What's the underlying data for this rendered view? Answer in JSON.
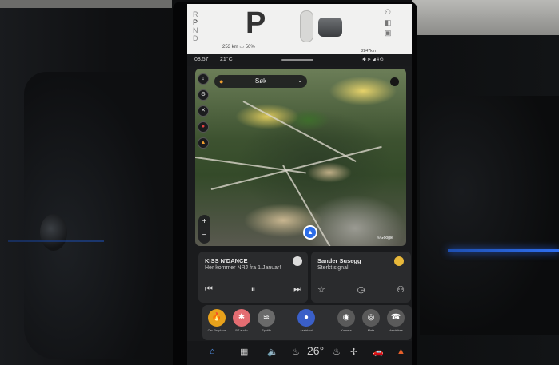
{
  "status": {
    "gears": [
      "R",
      "P",
      "N",
      "D"
    ],
    "current_gear": "P",
    "range": "253 km",
    "battery": "56%",
    "odometer": "2847km"
  },
  "topbar": {
    "time": "08:57",
    "outside_temp": "21°C",
    "network": "4G"
  },
  "map": {
    "search_placeholder": "Søk",
    "zoom_in": "+",
    "zoom_out": "−",
    "attribution": "©Google"
  },
  "media_card": {
    "station": "KISS N'DANCE",
    "track": "Her kommer NRJ fra 1.Januar!",
    "controls": [
      "previous",
      "pause",
      "next"
    ]
  },
  "contact_card": {
    "name": "Sander Susegg",
    "status": "Sterkt signal"
  },
  "apps": [
    {
      "label": "Car Fireplace",
      "icon": "flame-icon",
      "color": "#e8a21b"
    },
    {
      "label": "BT audio",
      "icon": "bluetooth-icon",
      "color": "#e46d72"
    },
    {
      "label": "Spotify",
      "icon": "spotify-icon",
      "color": "#6a6a6a"
    },
    {
      "label": "Assistant",
      "icon": "mic-icon",
      "color": "#3a5fc8"
    },
    {
      "label": "Kamera",
      "icon": "camera-icon",
      "color": "#5a5a5a"
    },
    {
      "label": "Mate",
      "icon": "steering-icon",
      "color": "#5a5a5a"
    },
    {
      "label": "Handsfree",
      "icon": "phone-icon",
      "color": "#5a5a5a"
    }
  ],
  "dock": {
    "cabin_temp": "26°",
    "items": [
      "home-icon",
      "apps-grid-icon",
      "volume-icon",
      "seat-heat-left-icon",
      "seat-heat-right-icon",
      "fan-icon",
      "car-icon",
      "hazard-icon"
    ]
  }
}
